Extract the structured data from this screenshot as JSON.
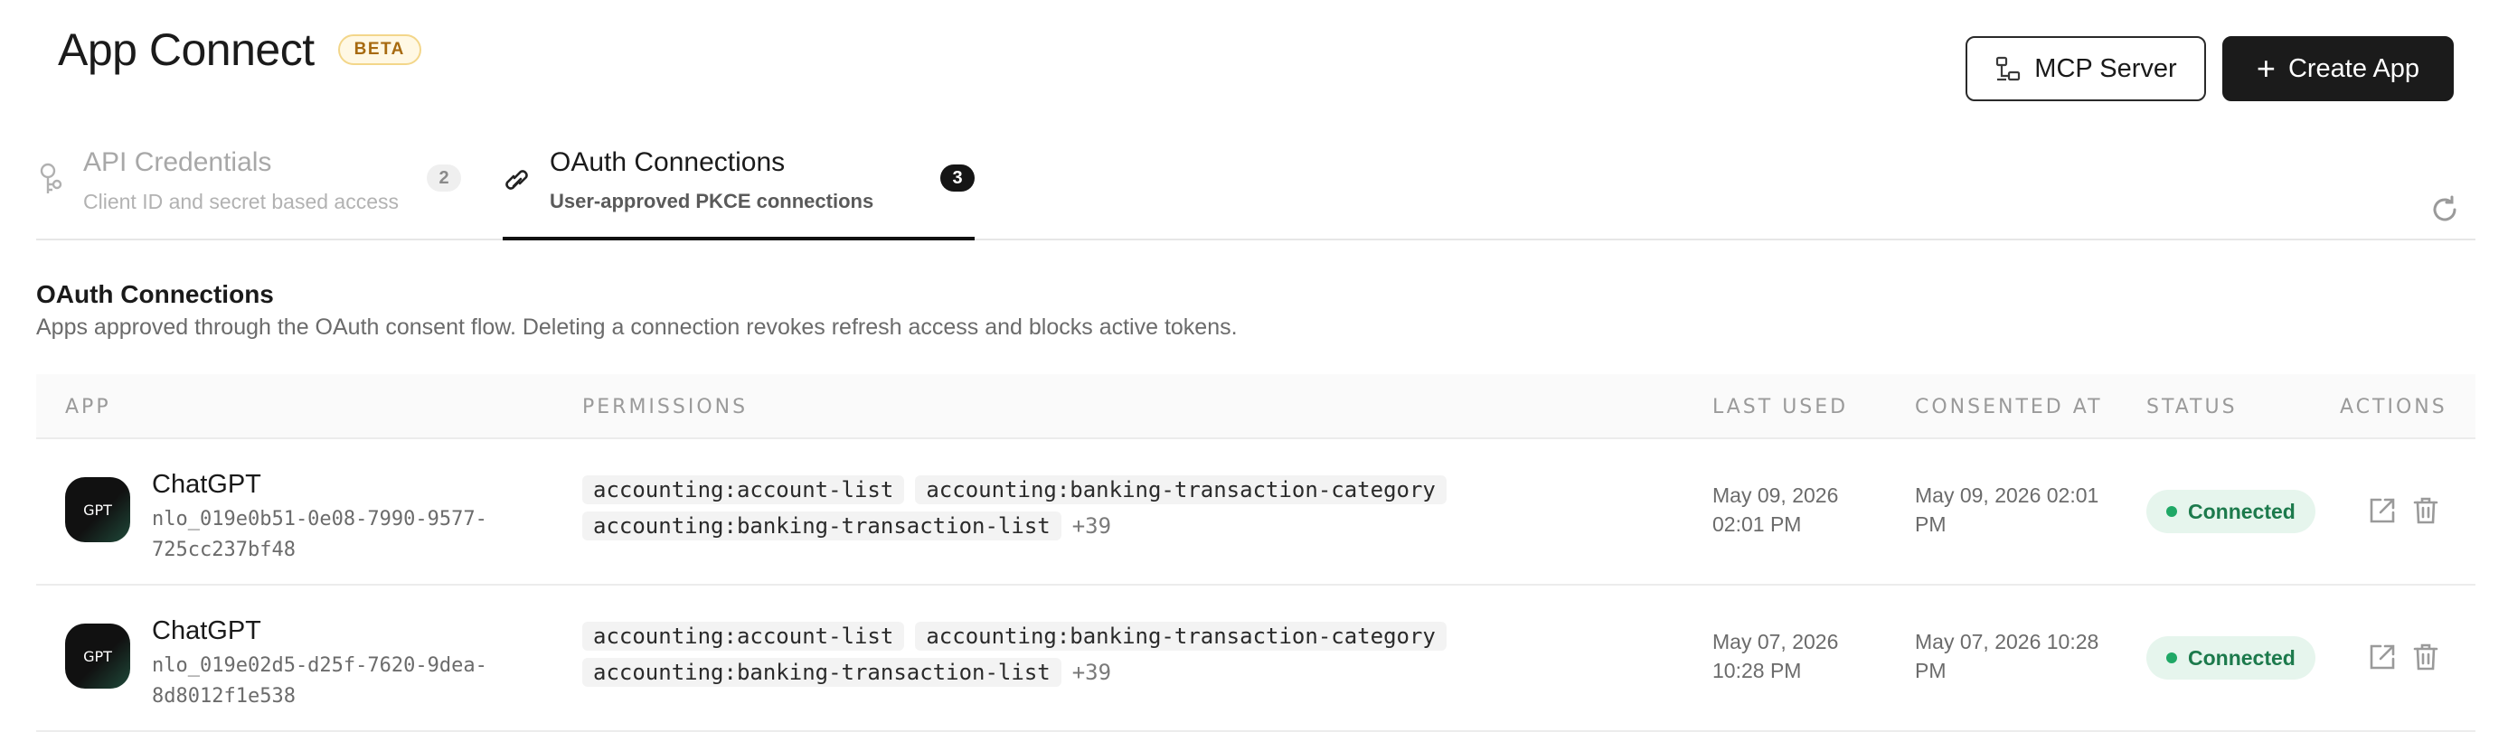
{
  "header": {
    "title": "App Connect",
    "badge": "BETA",
    "mcp_button": "MCP Server",
    "create_button": "Create App"
  },
  "tabs": [
    {
      "title": "API Credentials",
      "subtitle": "Client ID and secret based access",
      "count": "2",
      "active": false
    },
    {
      "title": "OAuth Connections",
      "subtitle": "User-approved PKCE connections",
      "count": "3",
      "active": true
    }
  ],
  "section": {
    "title": "OAuth Connections",
    "description": "Apps approved through the OAuth consent flow. Deleting a connection revokes refresh access and blocks active tokens."
  },
  "table": {
    "columns": [
      "APP",
      "PERMISSIONS",
      "LAST USED",
      "CONSENTED AT",
      "STATUS",
      "ACTIONS"
    ],
    "rows": [
      {
        "avatar": "GPT",
        "name": "ChatGPT",
        "id": "nlo_019e0b51-0e08-7990-9577-725cc237bf48",
        "perm_a": "accounting:account-list",
        "perm_b": "accounting:banking-transaction-category",
        "perm_c": "accounting:banking-transaction-list",
        "perm_more": "+39",
        "last_used": "May 09, 2026 02:01 PM",
        "consented_at": "May 09, 2026 02:01 PM",
        "status": "Connected"
      },
      {
        "avatar": "GPT",
        "name": "ChatGPT",
        "id": "nlo_019e02d5-d25f-7620-9dea-8d8012f1e538",
        "perm_a": "accounting:account-list",
        "perm_b": "accounting:banking-transaction-category",
        "perm_c": "accounting:banking-transaction-list",
        "perm_more": "+39",
        "last_used": "May 07, 2026 10:28 PM",
        "consented_at": "May 07, 2026 10:28 PM",
        "status": "Connected"
      }
    ]
  },
  "icons": {
    "mcp": "server-network-icon",
    "create": "plus-icon",
    "api_tab": "key-icon",
    "oauth_tab": "link-icon",
    "refresh": "refresh-icon",
    "open": "external-link-icon",
    "delete": "trash-icon"
  },
  "colors": {
    "status_bg": "#e6f5ed",
    "status_text": "#1c7a4c",
    "badge_bg": "#fff8e4",
    "badge_text": "#a76a10"
  }
}
